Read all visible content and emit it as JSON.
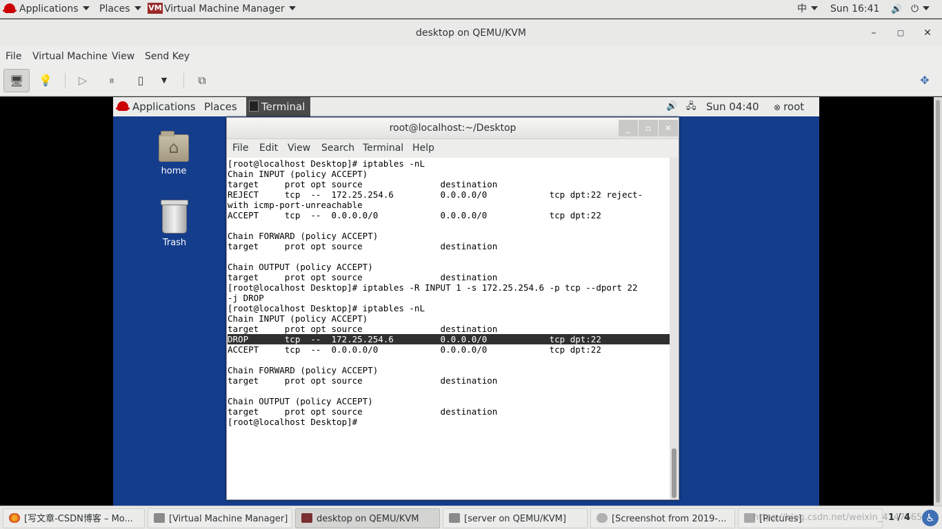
{
  "host_topbar": {
    "applications": "Applications",
    "places": "Places",
    "app_name": "Virtual Machine Manager",
    "input_method": "中",
    "clock": "Sun 16:41"
  },
  "vm_window": {
    "title": "desktop on QEMU/KVM",
    "minimize": "–",
    "maximize": "▢",
    "close": "✕",
    "menu": [
      "File",
      "Virtual Machine",
      "View",
      "Send Key"
    ]
  },
  "guest_topbar": {
    "applications": "Applications",
    "places": "Places",
    "terminal_task": "Terminal",
    "clock": "Sun 04:40",
    "user": "root"
  },
  "desktop_icons": {
    "home": "home",
    "trash": "Trash"
  },
  "terminal": {
    "title": "root@localhost:~/Desktop",
    "menu": [
      "File",
      "Edit",
      "View",
      "Search",
      "Terminal",
      "Help"
    ],
    "lines": [
      "[root@localhost Desktop]# iptables -nL",
      "Chain INPUT (policy ACCEPT)",
      "target     prot opt source               destination",
      "REJECT     tcp  --  172.25.254.6         0.0.0.0/0            tcp dpt:22 reject-",
      "with icmp-port-unreachable",
      "ACCEPT     tcp  --  0.0.0.0/0            0.0.0.0/0            tcp dpt:22",
      "",
      "Chain FORWARD (policy ACCEPT)",
      "target     prot opt source               destination",
      "",
      "Chain OUTPUT (policy ACCEPT)",
      "target     prot opt source               destination",
      "[root@localhost Desktop]# iptables -R INPUT 1 -s 172.25.254.6 -p tcp --dport 22",
      "-j DROP",
      "[root@localhost Desktop]# iptables -nL",
      "Chain INPUT (policy ACCEPT)",
      "target     prot opt source               destination",
      "DROP       tcp  --  172.25.254.6         0.0.0.0/0            tcp dpt:22         ",
      "ACCEPT     tcp  --  0.0.0.0/0            0.0.0.0/0            tcp dpt:22",
      "",
      "Chain FORWARD (policy ACCEPT)",
      "target     prot opt source               destination",
      "",
      "Chain OUTPUT (policy ACCEPT)",
      "target     prot opt source               destination",
      "[root@localhost Desktop]# "
    ]
  },
  "host_taskbar": {
    "tasks": [
      "[写文章-CSDN博客 – Mo...",
      "[Virtual Machine Manager]",
      "desktop on QEMU/KVM",
      "[server on QEMU/KVM]",
      "[Screenshot from 2019-...",
      "[Pictures]"
    ],
    "pager": "1 / 4",
    "watermark": "https://blog.csdn.net/weixin_41476658"
  },
  "colors": {
    "guest_desktop": "#143d8c",
    "redhat_red": "#cc0000",
    "highlight_row": "#303030"
  }
}
